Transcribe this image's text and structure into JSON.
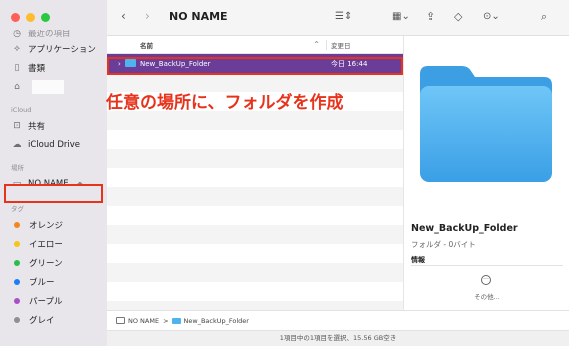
{
  "window": {
    "title": "NO NAME"
  },
  "sidebar": {
    "top_items": [
      {
        "icon": "clock-icon",
        "label": "最近の項目"
      },
      {
        "icon": "apps-icon",
        "label": "アプリケーション"
      },
      {
        "icon": "document-icon",
        "label": "書類"
      },
      {
        "icon": "home-icon",
        "label": ""
      }
    ],
    "icloud_header": "iCloud",
    "icloud_items": [
      {
        "icon": "shared-folder-icon",
        "label": "共有"
      },
      {
        "icon": "cloud-icon",
        "label": "iCloud Drive"
      }
    ],
    "locations_header": "場所",
    "locations_items": [
      {
        "icon": "drive-icon",
        "label": "NO NAME"
      }
    ],
    "tags_header": "タグ",
    "tags": [
      {
        "label": "オレンジ",
        "color": "#f7851e"
      },
      {
        "label": "イエロー",
        "color": "#f5c518"
      },
      {
        "label": "グリーン",
        "color": "#2dbb4a"
      },
      {
        "label": "ブルー",
        "color": "#1f7ef5"
      },
      {
        "label": "パープル",
        "color": "#a950c8"
      },
      {
        "label": "グレイ",
        "color": "#8e8e93"
      }
    ]
  },
  "list": {
    "col_name": "名前",
    "col_date": "変更日",
    "rows": [
      {
        "name": "New_BackUp_Folder",
        "date": "今日 16:44",
        "selected": true
      }
    ]
  },
  "annotation": "任意の場所に、フォルダを作成",
  "preview": {
    "name": "New_BackUp_Folder",
    "kind": "フォルダ - 0バイト",
    "info_label": "情報",
    "more_label": "その他..."
  },
  "pathbar": {
    "disk": "NO NAME",
    "separator": ">",
    "folder": "New_BackUp_Folder"
  },
  "status": "1項目中の1項目を選択、15.56 GB空き",
  "colors": {
    "selection": "#6a3d98",
    "highlight_box": "#e8331c",
    "folder_blue": "#4fb3f0"
  }
}
